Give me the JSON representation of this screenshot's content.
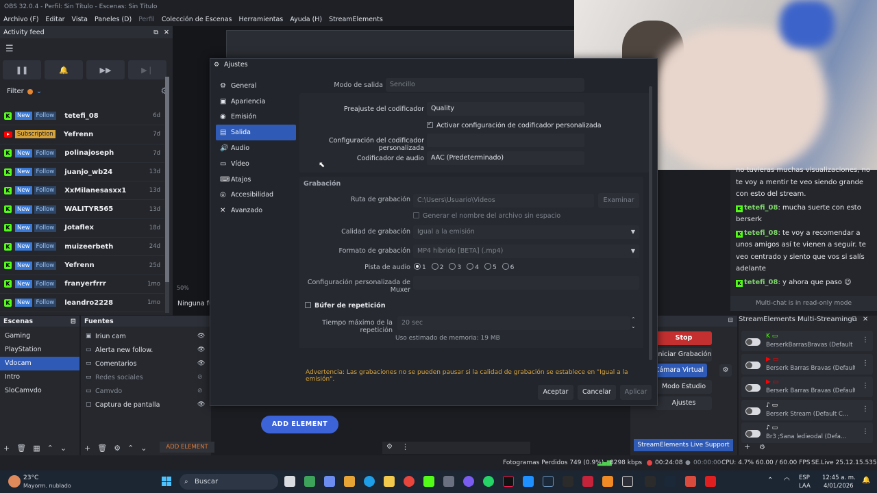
{
  "window": {
    "title": "OBS 32.0.4 - Perfil: Sin Título - Escenas: Sin Título"
  },
  "menu": [
    "Archivo (F)",
    "Editar",
    "Vista",
    "Paneles (D)",
    "Perfil",
    "Colección de Escenas",
    "Herramientas",
    "Ayuda (H)",
    "StreamElements"
  ],
  "activity": {
    "title": "Activity feed",
    "filter_label": "Filter",
    "items": [
      {
        "platform": "kick",
        "badge": "New",
        "type": "Follow",
        "name": "tetefi_08",
        "time": "6d"
      },
      {
        "platform": "youtube",
        "badge": "",
        "type": "Subscription",
        "name": "Yefrenn",
        "time": "7d"
      },
      {
        "platform": "kick",
        "badge": "New",
        "type": "Follow",
        "name": "polinajoseph",
        "time": "7d"
      },
      {
        "platform": "kick",
        "badge": "New",
        "type": "Follow",
        "name": "juanjo_wb24",
        "time": "13d"
      },
      {
        "platform": "kick",
        "badge": "New",
        "type": "Follow",
        "name": "XxMilanesasxx1",
        "time": "13d"
      },
      {
        "platform": "kick",
        "badge": "New",
        "type": "Follow",
        "name": "WALITYR565",
        "time": "13d"
      },
      {
        "platform": "kick",
        "badge": "New",
        "type": "Follow",
        "name": "Jotaflex",
        "time": "18d"
      },
      {
        "platform": "kick",
        "badge": "New",
        "type": "Follow",
        "name": "muizeerbeth",
        "time": "24d"
      },
      {
        "platform": "kick",
        "badge": "New",
        "type": "Follow",
        "name": "Yefrenn",
        "time": "25d"
      },
      {
        "platform": "kick",
        "badge": "New",
        "type": "Follow",
        "name": "franyerfrrr",
        "time": "1mo"
      },
      {
        "platform": "kick",
        "badge": "New",
        "type": "Follow",
        "name": "leandro2228",
        "time": "1mo"
      }
    ]
  },
  "preview": {
    "zoom": "50%",
    "no_source": "Ninguna fu"
  },
  "scenes": {
    "title": "Escenas",
    "items": [
      {
        "label": "Gaming",
        "selected": false
      },
      {
        "label": "PlayStation",
        "selected": false
      },
      {
        "label": "Vdocam",
        "selected": true
      },
      {
        "label": "Intro",
        "selected": false
      },
      {
        "label": "SloCamvdo",
        "selected": false
      }
    ]
  },
  "sources": {
    "title": "Fuentes",
    "items": [
      {
        "label": "Iriun cam",
        "visible": true
      },
      {
        "label": "Alerta new follow.",
        "visible": true
      },
      {
        "label": "Comentarios",
        "visible": true
      },
      {
        "label": "Redes sociales",
        "visible": false
      },
      {
        "label": "Camvdo",
        "visible": false
      },
      {
        "label": "Captura de pantalla",
        "visible": true
      }
    ],
    "add_element_small": "ADD ELEMENT",
    "add_element_big": "ADD ELEMENT"
  },
  "settings": {
    "title": "Ajustes",
    "nav": [
      {
        "label": "General",
        "icon": "⚙",
        "selected": false
      },
      {
        "label": "Apariencia",
        "icon": "▣",
        "selected": false
      },
      {
        "label": "Emisión",
        "icon": "◉",
        "selected": false
      },
      {
        "label": "Salida",
        "icon": "▤",
        "selected": true
      },
      {
        "label": "Audio",
        "icon": "🔊",
        "selected": false
      },
      {
        "label": "Vídeo",
        "icon": "▭",
        "selected": false
      },
      {
        "label": "Atajos",
        "icon": "⌨",
        "selected": false
      },
      {
        "label": "Accesibilidad",
        "icon": "◎",
        "selected": false
      },
      {
        "label": "Avanzado",
        "icon": "✕",
        "selected": false
      }
    ],
    "output_mode_label": "Modo de salida",
    "output_mode_value": "Sencillo",
    "encoder_preset_label": "Preajuste del codificador",
    "encoder_preset_value": "Quality",
    "custom_encoder_check": "Activar configuración de codificador personalizada",
    "custom_encoder_label": "Configuración del codificador personalizada",
    "audio_encoder_label": "Codificador de audio",
    "audio_encoder_value": "AAC (Predeterminado)",
    "recording_section": "Grabación",
    "rec_path_label": "Ruta de grabación",
    "rec_path_value": "C:\\Users\\Usuario\\Videos",
    "browse_button": "Examinar",
    "no_space_check": "Generar el nombre del archivo sin espacio",
    "rec_quality_label": "Calidad de grabación",
    "rec_quality_value": "Igual a la emisión",
    "rec_format_label": "Formato de grabación",
    "rec_format_value": "MP4 híbrido [BETA] (.mp4)",
    "audio_track_label": "Pista de audio",
    "audio_tracks": [
      "1",
      "2",
      "3",
      "4",
      "5",
      "6"
    ],
    "muxer_label": "Configuración personalizada de Muxer",
    "replay_buffer_label": "Búfer de repetición",
    "replay_max_label": "Tiempo máximo de la repetición",
    "replay_max_value": "20 sec",
    "memory_usage": "Uso estimado de memoria: 19 MB",
    "warning": "Advertencia: Las grabaciones no se pueden pausar si la calidad de grabación se establece en \"Igual a la emisión\".",
    "accept": "Aceptar",
    "cancel": "Cancelar",
    "apply": "Aplicar"
  },
  "chat": {
    "lines_top": [
      "no tuvieras muchas visualizaciones, no",
      "te voy a mentir te veo siendo grande",
      "con esto del stream."
    ],
    "messages": [
      {
        "user": "tetefi_08",
        "text": ": mucha suerte con esto berserk"
      },
      {
        "user": "tetefi_08",
        "text": ": te voy a recomendar a unos amigos así te vienen a seguir. te veo centrado y siento que vos si salís adelante"
      },
      {
        "user": "tetefi_08",
        "text": ": y ahora que paso 😉"
      }
    ],
    "footer": "Multi-chat is in read-only mode"
  },
  "controls": {
    "stop_streaming": "Stop Streaming",
    "start_recording": "Iniciar Grabación",
    "virtual_cam": "her Cámara Virtual",
    "studio_mode": "Modo Estudio",
    "settings": "Ajustes",
    "support": "StreamElements Live Support"
  },
  "multistream": {
    "title": "StreamElements Multi-Streaming",
    "rows": [
      {
        "platform": "kick",
        "name": "BerserkBarrasBravas (Default ..."
      },
      {
        "platform": "youtube",
        "name": "Berserk Barras Bravas (Default ..."
      },
      {
        "platform": "youtube",
        "name": "Berserk Barras Bravas (Default ..."
      },
      {
        "platform": "tiktok",
        "name": "Berserk Stream (Default C..."
      },
      {
        "platform": "tiktok",
        "name": "Br3 ;Sana ledieodal (Defa..."
      }
    ]
  },
  "statusbar": {
    "dropped": "Fotogramas Perdidos 749 (0.9%)",
    "kbps": "8298 kbps",
    "stream_time": "00:24:08",
    "rec_time": "00:00:00",
    "cpu": "CPU: 4.7%",
    "fps": "60.00 / 60.00 FPS",
    "version": "SE.Live 25.12.15.535"
  },
  "taskbar": {
    "weather_temp": "23°C",
    "weather_desc": "Mayorm. nublado",
    "search": "Buscar",
    "lang1": "ESP",
    "lang2": "LAA",
    "time": "12:45 a. m.",
    "date": "4/01/2026"
  },
  "colors": {
    "accent": "#2f5bb7",
    "kick": "#53fc18",
    "youtube": "#ff0000",
    "warning": "#d9a43c",
    "stop": "#c43030"
  }
}
